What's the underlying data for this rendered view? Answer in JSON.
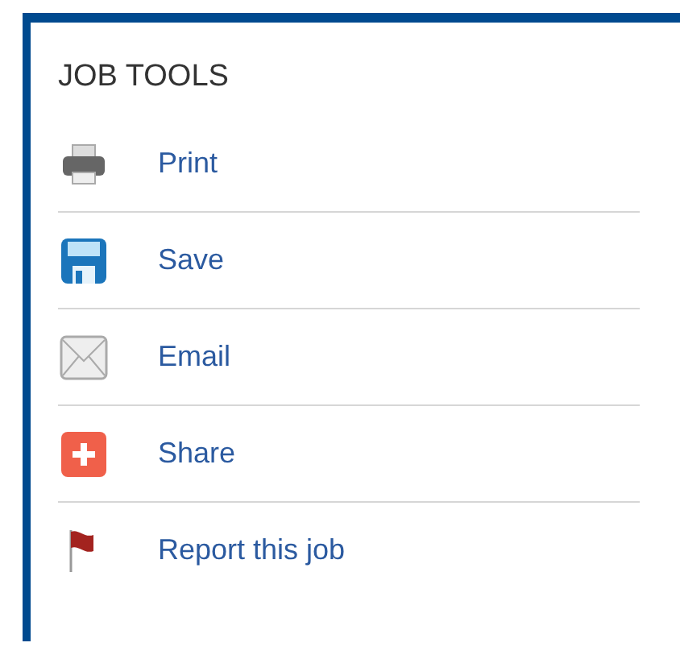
{
  "panel": {
    "title": "JOB TOOLS",
    "items": [
      {
        "kind": "print",
        "label": "Print"
      },
      {
        "kind": "save",
        "label": "Save"
      },
      {
        "kind": "email",
        "label": "Email"
      },
      {
        "kind": "share",
        "label": "Share"
      },
      {
        "kind": "report",
        "label": "Report this job"
      }
    ]
  }
}
